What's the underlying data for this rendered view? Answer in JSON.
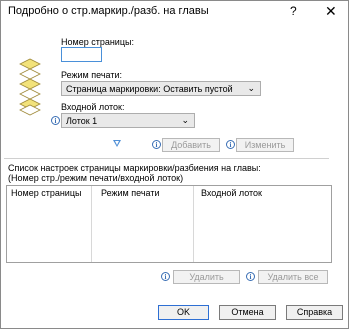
{
  "window": {
    "title": "Подробно о стр.маркир./разб. на главы",
    "help": "?",
    "close": "✕"
  },
  "fields": {
    "page_number_label": "Номер страницы:",
    "page_number_value": "",
    "print_mode_label": "Режим печати:",
    "print_mode_value": "Страница маркировки: Оставить пустой",
    "input_tray_label": "Входной лоток:",
    "input_tray_value": "Лоток 1"
  },
  "actions": {
    "add": "Добавить",
    "modify": "Изменить",
    "delete": "Удалить",
    "delete_all": "Удалить все"
  },
  "list": {
    "title_line1": "Список настроек страницы маркировки/разбиения на главы:",
    "title_line2": "(Номер стр./режим печати/входной лоток)",
    "columns": [
      "Номер страницы",
      "Режим печати",
      "Входной лоток"
    ],
    "rows": []
  },
  "footer": {
    "ok": "OK",
    "cancel": "Отмена",
    "help": "Справка"
  },
  "colors": {
    "accent": "#2e6fd3",
    "info": "#3a6fb5",
    "paper_yellow": "#f2e27a"
  }
}
